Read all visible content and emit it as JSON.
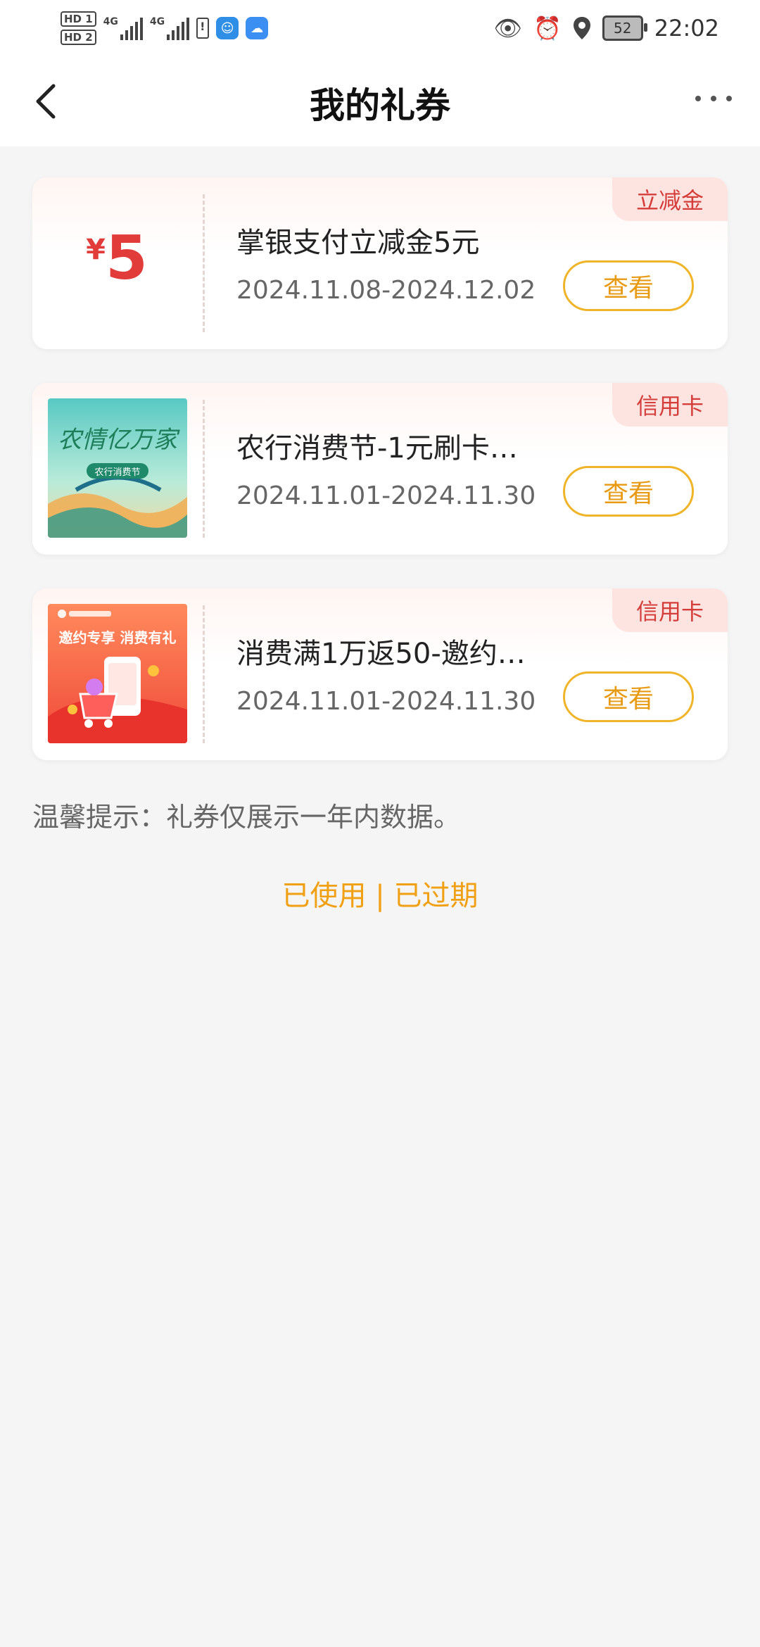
{
  "status_bar": {
    "sim1": "HD 1",
    "sim2": "HD 2",
    "net1": "4G",
    "net2": "4G",
    "battery_level": "52",
    "time": "22:02"
  },
  "header": {
    "title": "我的礼券"
  },
  "coupons": [
    {
      "tag": "立减金",
      "currency": "¥",
      "amount": "5",
      "title": "掌银支付立减金5元",
      "date_range": "2024.11.08-2024.12.02",
      "action_label": "查看"
    },
    {
      "tag": "信用卡",
      "image_text": "农情亿万家",
      "image_subtext": "农行消费节",
      "title": "农行消费节-1元刷卡…",
      "date_range": "2024.11.01-2024.11.30",
      "action_label": "查看"
    },
    {
      "tag": "信用卡",
      "image_text": "邀约专享 消费有礼",
      "title": "消费满1万返50-邀约…",
      "date_range": "2024.11.01-2024.11.30",
      "action_label": "查看"
    }
  ],
  "tip": "温馨提示：礼券仅展示一年内数据。",
  "links": {
    "used": "已使用",
    "separator": "|",
    "expired": "已过期"
  }
}
